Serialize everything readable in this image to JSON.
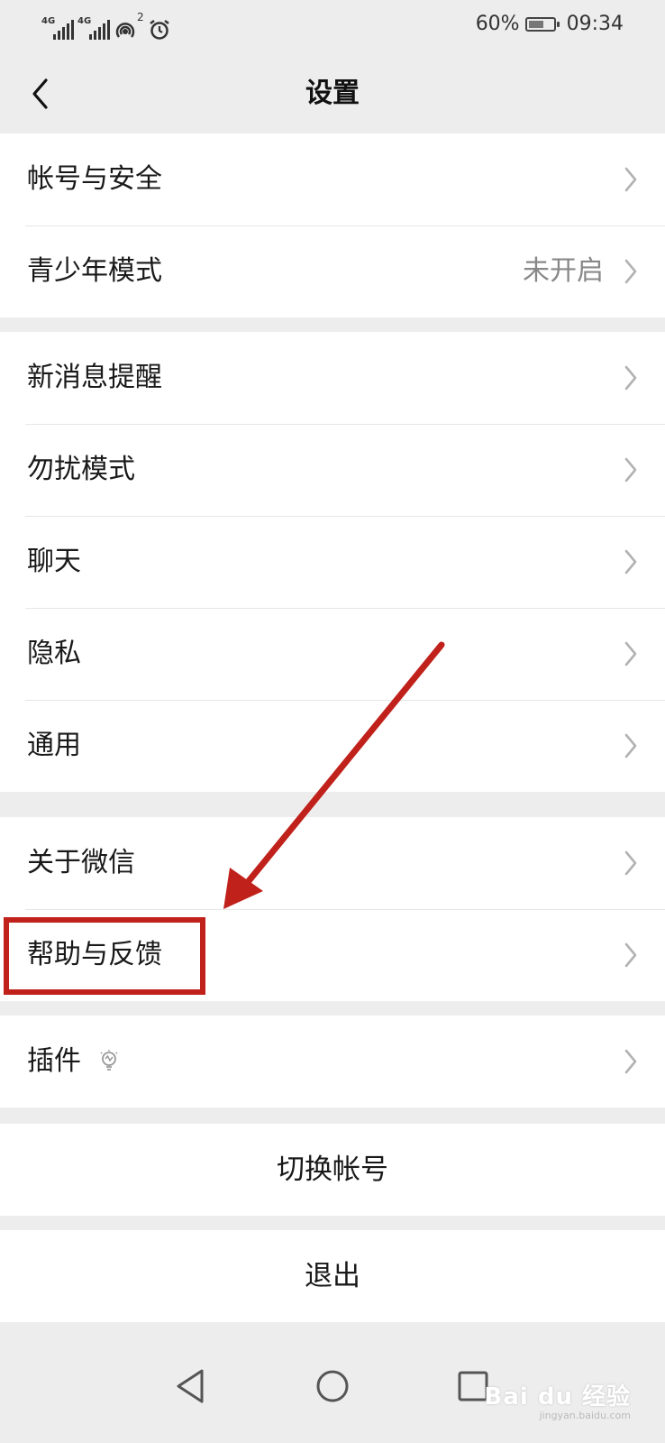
{
  "status_bar": {
    "signal_1": "4G",
    "signal_2": "4G",
    "hotspot_count": "2",
    "battery_percent": "60%",
    "time": "09:34",
    "battery_level": 0.6
  },
  "header": {
    "title": "设置"
  },
  "groups": [
    {
      "items": [
        {
          "label": "帐号与安全",
          "value": ""
        },
        {
          "label": "青少年模式",
          "value": "未开启"
        }
      ]
    },
    {
      "items": [
        {
          "label": "新消息提醒",
          "value": ""
        },
        {
          "label": "勿扰模式",
          "value": ""
        },
        {
          "label": "聊天",
          "value": ""
        },
        {
          "label": "隐私",
          "value": ""
        },
        {
          "label": "通用",
          "value": ""
        }
      ]
    },
    {
      "items": [
        {
          "label": "关于微信",
          "value": ""
        },
        {
          "label": "帮助与反馈",
          "value": ""
        }
      ]
    },
    {
      "items": [
        {
          "label": "插件",
          "value": "",
          "icon": "lightbulb-icon"
        }
      ]
    }
  ],
  "actions": {
    "switch_account": "切换帐号",
    "logout": "退出"
  },
  "annotation": {
    "highlight_color": "#c0211b",
    "target": "帮助与反馈"
  },
  "watermark": {
    "brand": "Bai du 经验",
    "url": "jingyan.baidu.com"
  }
}
